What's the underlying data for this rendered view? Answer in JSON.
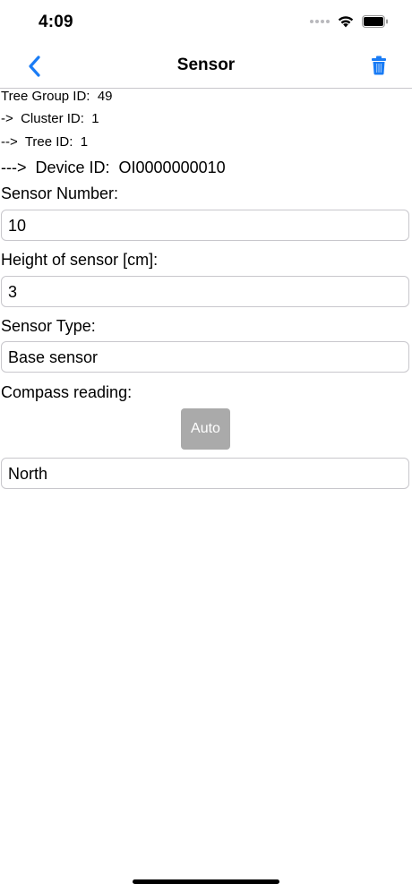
{
  "status_bar": {
    "time": "4:09"
  },
  "nav": {
    "title": "Sensor",
    "back_icon": "chevron-left-icon",
    "trash_icon": "trash-icon",
    "accent_color": "#1a7cf5"
  },
  "ids": {
    "tree_group": "Tree Group ID:  49",
    "cluster": "->  Cluster ID:  1",
    "tree": "-->  Tree ID:  1",
    "device": "--->  Device ID:  OI0000000010"
  },
  "form": {
    "sensor_number_label": "Sensor Number:",
    "sensor_number_value": "10",
    "height_label": "Height of sensor [cm]:",
    "height_value": "3",
    "sensor_type_label": "Sensor Type:",
    "sensor_type_value": "Base sensor",
    "compass_label": "Compass reading:",
    "auto_button_label": "Auto",
    "compass_value": "North"
  }
}
